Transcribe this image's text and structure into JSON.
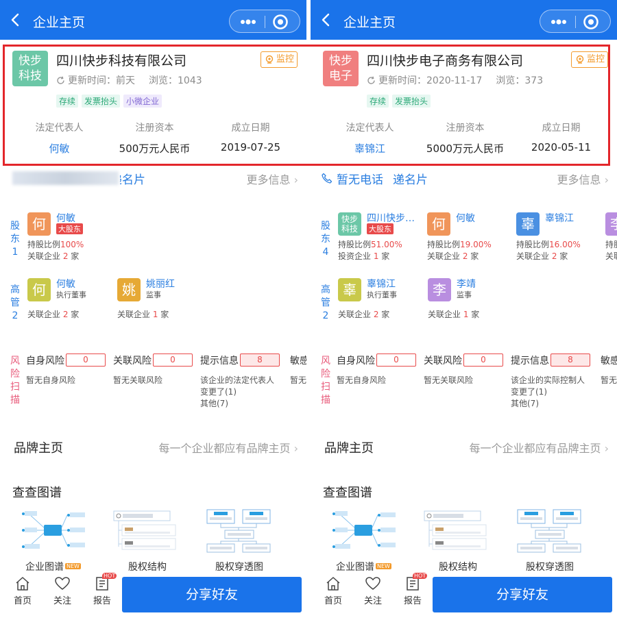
{
  "panels": [
    {
      "header_title": "企业主页",
      "logo_text": "快步科技",
      "logo_color": "#6cc7a7",
      "company_name": "四川快步科技有限公司",
      "monitor_label": "监控",
      "update_text": "更新时间：前天",
      "views_text": "浏览：1043",
      "tags": [
        "存续",
        "发票抬头",
        "小微企业"
      ],
      "info": [
        {
          "label": "法定代表人",
          "value": "何敏"
        },
        {
          "label": "注册资本",
          "value": "500万元人民币"
        },
        {
          "label": "成立日期",
          "value": "2019-07-25"
        }
      ],
      "contact": {
        "phone": "",
        "card": "递名片",
        "more": "更多信息"
      },
      "shareholders_label": [
        "股",
        "东",
        "1"
      ],
      "shareholders": [
        {
          "avatar": "何",
          "avatar_color": "#f0955a",
          "name": "何敏",
          "badge": "大股东",
          "line1_prefix": "持股比例",
          "line1_value": "100%",
          "line2_prefix": "关联企业 ",
          "line2_value": "2",
          "line2_suffix": " 家"
        }
      ],
      "executives_label": [
        "高",
        "管",
        "2"
      ],
      "executives": [
        {
          "avatar": "何",
          "avatar_color": "#c9c94a",
          "name": "何敏",
          "role": "执行董事",
          "line_prefix": "关联企业 ",
          "line_value": "2",
          "line_suffix": " 家"
        },
        {
          "avatar": "姚",
          "avatar_color": "#e6a935",
          "name": "姚丽红",
          "role": "监事",
          "line_prefix": "关联企业 ",
          "line_value": "1",
          "line_suffix": " 家"
        }
      ],
      "risk_label": [
        "风",
        "险",
        "扫",
        "描"
      ],
      "risks": [
        {
          "name": "自身风险",
          "count": "0",
          "desc": "暂无自身风险"
        },
        {
          "name": "关联风险",
          "count": "0",
          "desc": "暂无关联风险"
        },
        {
          "name": "提示信息",
          "count": "8",
          "desc": "该企业的法定代表人变更了(1)\n其他(7)"
        },
        {
          "name": "敏感",
          "count": "",
          "desc": "暂无"
        }
      ],
      "brand_title": "品牌主页",
      "brand_sub": "每一个企业都应有品牌主页",
      "graph_title": "查查图谱",
      "graphs": [
        "企业图谱",
        "股权结构",
        "股权穿透图"
      ],
      "new_badge": "NEW",
      "tabs": [
        "首页",
        "关注",
        "报告"
      ],
      "hot_badge": "HOT",
      "share_label": "分享好友"
    },
    {
      "header_title": "企业主页",
      "logo_text": "快步电子",
      "logo_color": "#f07f7f",
      "company_name": "四川快步电子商务有限公司",
      "monitor_label": "监控",
      "update_text": "更新时间：2020-11-17",
      "views_text": "浏览：373",
      "tags": [
        "存续",
        "发票抬头"
      ],
      "info": [
        {
          "label": "法定代表人",
          "value": "辜锦江"
        },
        {
          "label": "注册资本",
          "value": "5000万元人民币"
        },
        {
          "label": "成立日期",
          "value": "2020-05-11"
        }
      ],
      "contact": {
        "phone": "暂无电话",
        "card": "递名片",
        "more": "更多信息"
      },
      "shareholders_label": [
        "股",
        "东",
        "4"
      ],
      "shareholders": [
        {
          "avatar": "快步科技",
          "avatar_color": "#6cc7a7",
          "name": "四川快步…",
          "badge": "大股东",
          "line1_prefix": "持股比例",
          "line1_value": "51.00%",
          "line2_prefix": "投资企业 ",
          "line2_value": "1",
          "line2_suffix": " 家"
        },
        {
          "avatar": "何",
          "avatar_color": "#f0955a",
          "name": "何敏",
          "badge": "",
          "line1_prefix": "持股比例",
          "line1_value": "19.00%",
          "line2_prefix": "关联企业 ",
          "line2_value": "2",
          "line2_suffix": " 家"
        },
        {
          "avatar": "辜",
          "avatar_color": "#4a90e2",
          "name": "辜锦江",
          "badge": "",
          "line1_prefix": "持股比例",
          "line1_value": "16.00%",
          "line2_prefix": "关联企业 ",
          "line2_value": "2",
          "line2_suffix": " 家"
        },
        {
          "avatar": "李",
          "avatar_color": "#b98ee0",
          "name": "",
          "badge": "",
          "line1_prefix": "持股",
          "line1_value": "",
          "line2_prefix": "关联",
          "line2_value": "",
          "line2_suffix": ""
        }
      ],
      "executives_label": [
        "高",
        "管",
        "2"
      ],
      "executives": [
        {
          "avatar": "辜",
          "avatar_color": "#c9c94a",
          "name": "辜锦江",
          "role": "执行董事",
          "line_prefix": "关联企业 ",
          "line_value": "2",
          "line_suffix": " 家"
        },
        {
          "avatar": "李",
          "avatar_color": "#b98ee0",
          "name": "李靖",
          "role": "监事",
          "line_prefix": "关联企业 ",
          "line_value": "1",
          "line_suffix": " 家"
        }
      ],
      "risk_label": [
        "风",
        "险",
        "扫",
        "描"
      ],
      "risks": [
        {
          "name": "自身风险",
          "count": "0",
          "desc": "暂无自身风险"
        },
        {
          "name": "关联风险",
          "count": "0",
          "desc": "暂无关联风险"
        },
        {
          "name": "提示信息",
          "count": "8",
          "desc": "该企业的实际控制人变更了(1)\n其他(7)"
        },
        {
          "name": "敏感",
          "count": "",
          "desc": "暂无"
        }
      ],
      "brand_title": "品牌主页",
      "brand_sub": "每一个企业都应有品牌主页",
      "graph_title": "查查图谱",
      "graphs": [
        "企业图谱",
        "股权结构",
        "股权穿透图"
      ],
      "new_badge": "NEW",
      "tabs": [
        "首页",
        "关注",
        "报告"
      ],
      "hot_badge": "HOT",
      "share_label": "分享好友"
    }
  ],
  "colors": {
    "brand_blue": "#1a73ea",
    "highlight_red": "#e3262b",
    "monitor_orange": "#f39a2b",
    "risk_red": "#e84a4a",
    "link_blue": "#2a7ee0"
  },
  "icons": {
    "back": "chevron-left-icon",
    "more": "more-dots-icon",
    "close": "target-circle-icon",
    "monitor": "eye-icon",
    "refresh": "refresh-icon",
    "phone": "phone-icon",
    "home": "home-icon",
    "follow": "heart-icon",
    "report": "report-icon"
  }
}
